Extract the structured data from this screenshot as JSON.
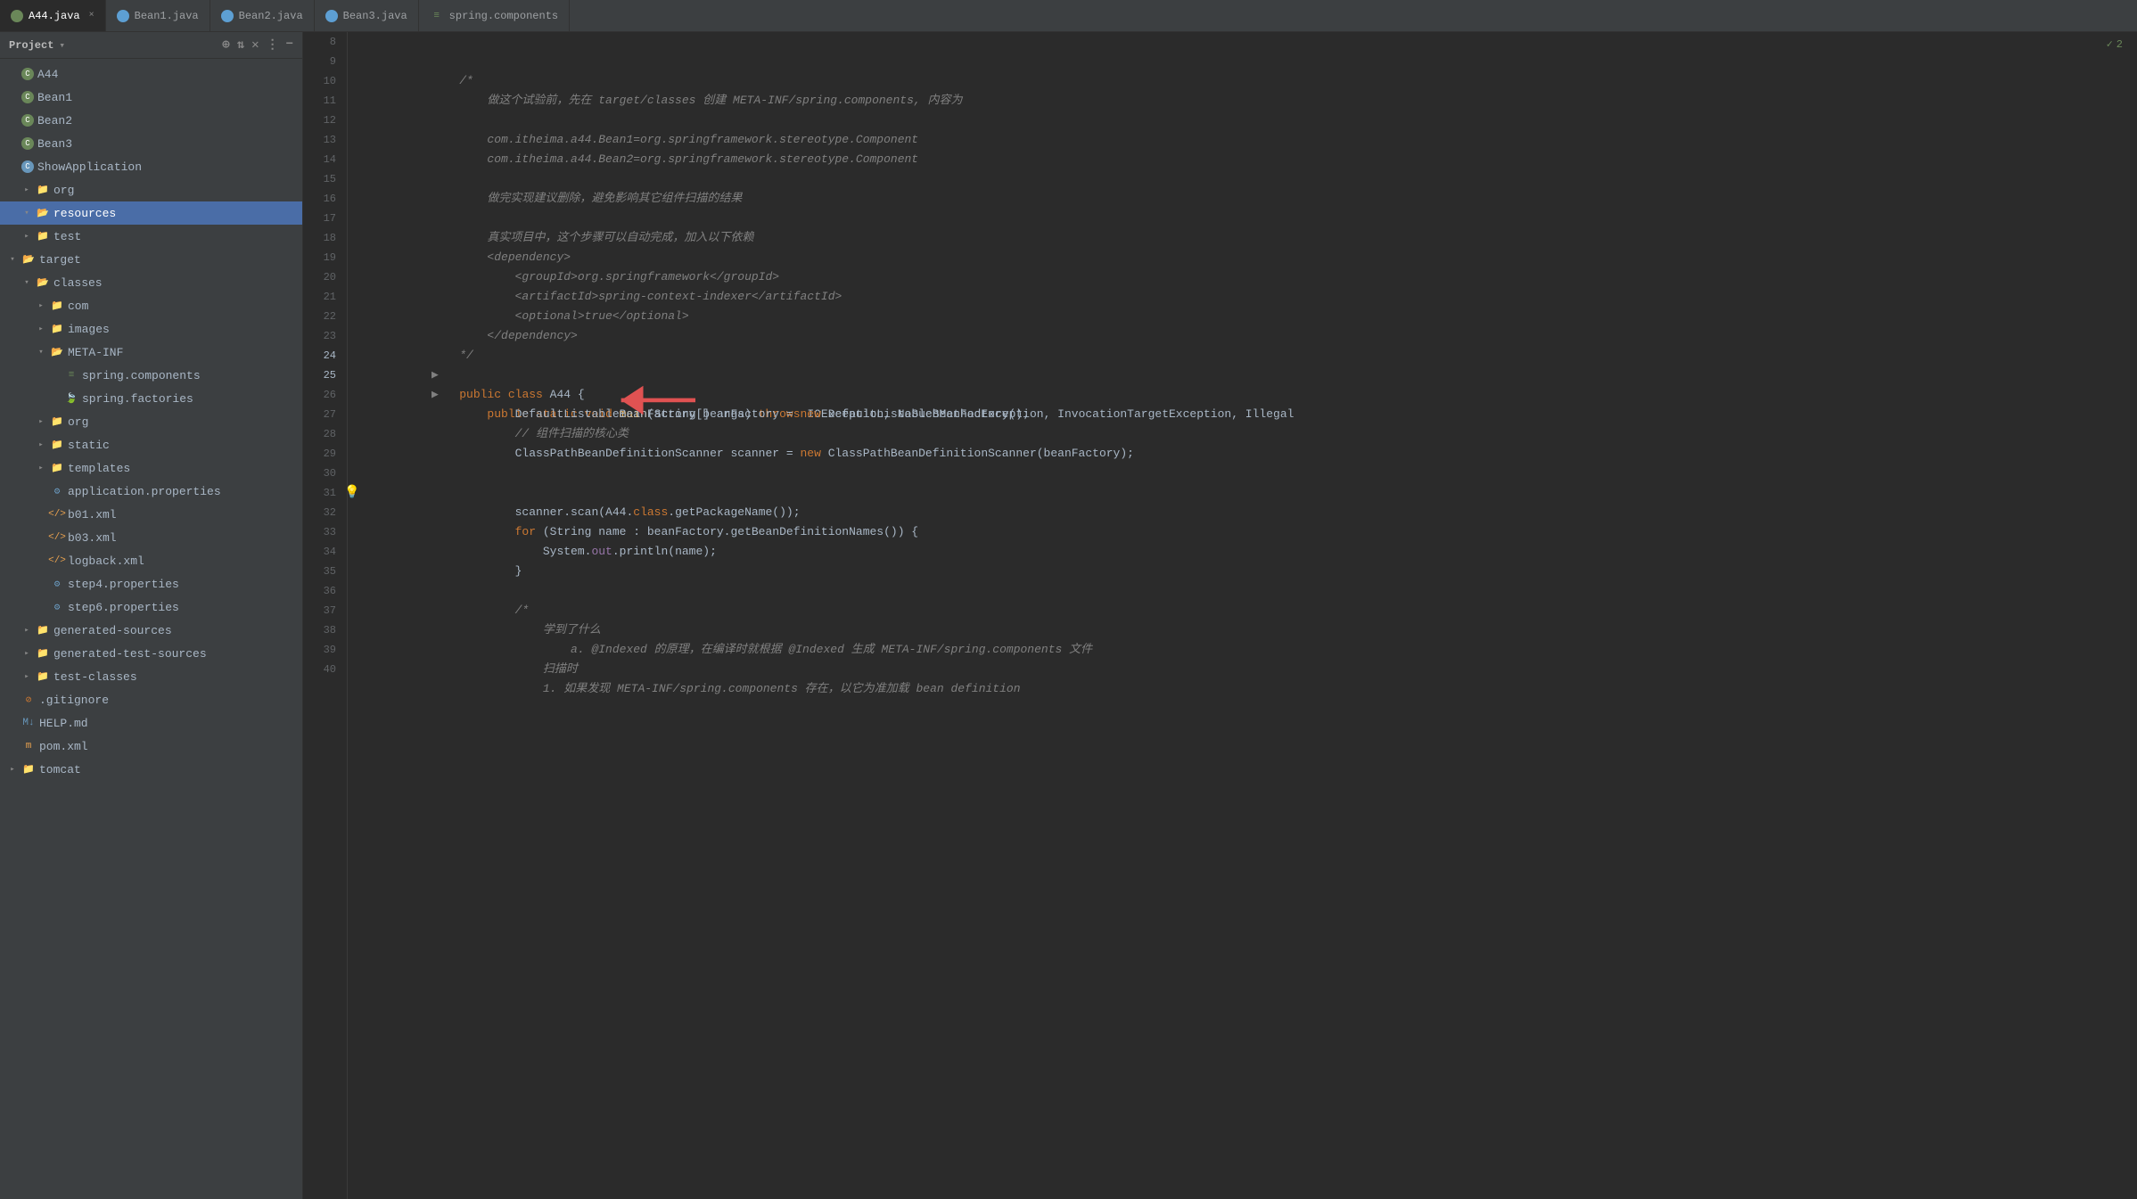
{
  "project": {
    "title": "Project",
    "dropdown_icon": "▾"
  },
  "tabs": [
    {
      "id": "A44.java",
      "label": "A44.java",
      "active": true,
      "icon_type": "green",
      "closeable": true
    },
    {
      "id": "Bean1.java",
      "label": "Bean1.java",
      "active": false,
      "icon_type": "blue",
      "closeable": false
    },
    {
      "id": "Bean2.java",
      "label": "Bean2.java",
      "active": false,
      "icon_type": "blue",
      "closeable": false
    },
    {
      "id": "Bean3.java",
      "label": "Bean3.java",
      "active": false,
      "icon_type": "blue",
      "closeable": false
    },
    {
      "id": "spring.components",
      "label": "spring.components",
      "active": false,
      "icon_type": "spring",
      "closeable": false
    }
  ],
  "sidebar": {
    "title": "Project",
    "tree": [
      {
        "id": "A44",
        "label": "A44",
        "indent": 0,
        "type": "java",
        "arrow": "leaf"
      },
      {
        "id": "Bean1",
        "label": "Bean1",
        "indent": 0,
        "type": "java",
        "arrow": "leaf"
      },
      {
        "id": "Bean2",
        "label": "Bean2",
        "indent": 0,
        "type": "java",
        "arrow": "leaf"
      },
      {
        "id": "Bean3",
        "label": "Bean3",
        "indent": 0,
        "type": "java",
        "arrow": "leaf"
      },
      {
        "id": "ShowApplication",
        "label": "ShowApplication",
        "indent": 0,
        "type": "show",
        "arrow": "leaf"
      },
      {
        "id": "org",
        "label": "org",
        "indent": 1,
        "type": "folder",
        "arrow": "closed"
      },
      {
        "id": "resources",
        "label": "resources",
        "indent": 1,
        "type": "folder",
        "arrow": "open",
        "selected": true
      },
      {
        "id": "test",
        "label": "test",
        "indent": 1,
        "type": "folder",
        "arrow": "closed"
      },
      {
        "id": "target",
        "label": "target",
        "indent": 0,
        "type": "folder",
        "arrow": "open"
      },
      {
        "id": "classes",
        "label": "classes",
        "indent": 1,
        "type": "folder",
        "arrow": "open"
      },
      {
        "id": "com",
        "label": "com",
        "indent": 2,
        "type": "folder",
        "arrow": "closed"
      },
      {
        "id": "images",
        "label": "images",
        "indent": 2,
        "type": "folder",
        "arrow": "closed"
      },
      {
        "id": "META-INF",
        "label": "META-INF",
        "indent": 2,
        "type": "folder",
        "arrow": "open"
      },
      {
        "id": "spring.components",
        "label": "spring.components",
        "indent": 3,
        "type": "spring_comp",
        "arrow": "leaf"
      },
      {
        "id": "spring.factories",
        "label": "spring.factories",
        "indent": 3,
        "type": "spring_fact",
        "arrow": "leaf"
      },
      {
        "id": "org2",
        "label": "org",
        "indent": 2,
        "type": "folder",
        "arrow": "closed"
      },
      {
        "id": "static",
        "label": "static",
        "indent": 2,
        "type": "folder",
        "arrow": "closed"
      },
      {
        "id": "templates",
        "label": "templates",
        "indent": 2,
        "type": "folder",
        "arrow": "closed"
      },
      {
        "id": "application.properties",
        "label": "application.properties",
        "indent": 2,
        "type": "prop",
        "arrow": "leaf"
      },
      {
        "id": "b01.xml",
        "label": "b01.xml",
        "indent": 2,
        "type": "xml",
        "arrow": "leaf"
      },
      {
        "id": "b03.xml",
        "label": "b03.xml",
        "indent": 2,
        "type": "xml",
        "arrow": "leaf"
      },
      {
        "id": "logback.xml",
        "label": "logback.xml",
        "indent": 2,
        "type": "xml",
        "arrow": "leaf"
      },
      {
        "id": "step4.properties",
        "label": "step4.properties",
        "indent": 2,
        "type": "prop",
        "arrow": "leaf"
      },
      {
        "id": "step6.properties",
        "label": "step6.properties",
        "indent": 2,
        "type": "prop",
        "arrow": "leaf"
      },
      {
        "id": "generated-sources",
        "label": "generated-sources",
        "indent": 1,
        "type": "folder",
        "arrow": "closed"
      },
      {
        "id": "generated-test-sources",
        "label": "generated-test-sources",
        "indent": 1,
        "type": "folder",
        "arrow": "closed"
      },
      {
        "id": "test-classes",
        "label": "test-classes",
        "indent": 1,
        "type": "folder",
        "arrow": "closed"
      },
      {
        "id": ".gitignore",
        "label": ".gitignore",
        "indent": 0,
        "type": "gitignore",
        "arrow": "leaf"
      },
      {
        "id": "HELP.md",
        "label": "HELP.md",
        "indent": 0,
        "type": "md",
        "arrow": "leaf"
      },
      {
        "id": "pom.xml",
        "label": "pom.xml",
        "indent": 0,
        "type": "pom",
        "arrow": "leaf"
      },
      {
        "id": "tomcat",
        "label": "tomcat",
        "indent": 0,
        "type": "folder",
        "arrow": "closed"
      }
    ]
  },
  "code": {
    "lines": [
      {
        "num": 8,
        "content": ""
      },
      {
        "num": 9,
        "content": "    /*"
      },
      {
        "num": 10,
        "content": "        做这个试验前，先在 target/classes 创建 META-INF/spring.components, 内容为"
      },
      {
        "num": 11,
        "content": ""
      },
      {
        "num": 12,
        "content": "        com.itheima.a44.Bean1=org.springframework.stereotype.Component"
      },
      {
        "num": 13,
        "content": "        com.itheima.a44.Bean2=org.springframework.stereotype.Component"
      },
      {
        "num": 14,
        "content": ""
      },
      {
        "num": 15,
        "content": "        做完实现建议删除，避免影响其它组件扫描的结果"
      },
      {
        "num": 16,
        "content": ""
      },
      {
        "num": 17,
        "content": "        真实项目中，这个步骤可以自动完成，加入以下依赖"
      },
      {
        "num": 18,
        "content": "        <dependency>"
      },
      {
        "num": 19,
        "content": "            <groupId>org.springframework</groupId>"
      },
      {
        "num": 20,
        "content": "            <artifactId>spring-context-indexer</artifactId>"
      },
      {
        "num": 21,
        "content": "            <optional>true</optional>"
      },
      {
        "num": 22,
        "content": "        </dependency>"
      },
      {
        "num": 23,
        "content": "    */"
      },
      {
        "num": 24,
        "content": "    public class A44 {",
        "runnable": true
      },
      {
        "num": 25,
        "content": "        public static void main(String[] args) throws IOException, NoSuchMethodException, InvocationTargetException, Illegal",
        "runnable": true
      },
      {
        "num": 26,
        "content": "            DefaultListableBeanFactory beanFactory = new DefaultListableBeanFactory();"
      },
      {
        "num": 27,
        "content": "            // 组件扫描的核心类"
      },
      {
        "num": 28,
        "content": "            ClassPathBeanDefinitionScanner scanner = new ClassPathBeanDefinitionScanner(beanFactory);"
      },
      {
        "num": 29,
        "content": ""
      },
      {
        "num": 30,
        "content": "            scanner.scan(A44.class.getPackageName());",
        "bulb": true
      },
      {
        "num": 31,
        "content": ""
      },
      {
        "num": 32,
        "content": "            for (String name : beanFactory.getBeanDefinitionNames()) {"
      },
      {
        "num": 33,
        "content": "                System.out.println(name);"
      },
      {
        "num": 34,
        "content": "            }"
      },
      {
        "num": 35,
        "content": ""
      },
      {
        "num": 36,
        "content": "            /*"
      },
      {
        "num": 37,
        "content": "                学到了什么"
      },
      {
        "num": 38,
        "content": "                    a. @Indexed 的原理，在编译时就根据 @Indexed 生成 META-INF/spring.components 文件"
      },
      {
        "num": 39,
        "content": "                扫描时"
      },
      {
        "num": 40,
        "content": "                1. 如果发现 META-INF/spring.components 存在，以它为准加载 bean definition"
      }
    ]
  },
  "status": {
    "check_icon": "✓",
    "count": "2",
    "label": "2"
  }
}
